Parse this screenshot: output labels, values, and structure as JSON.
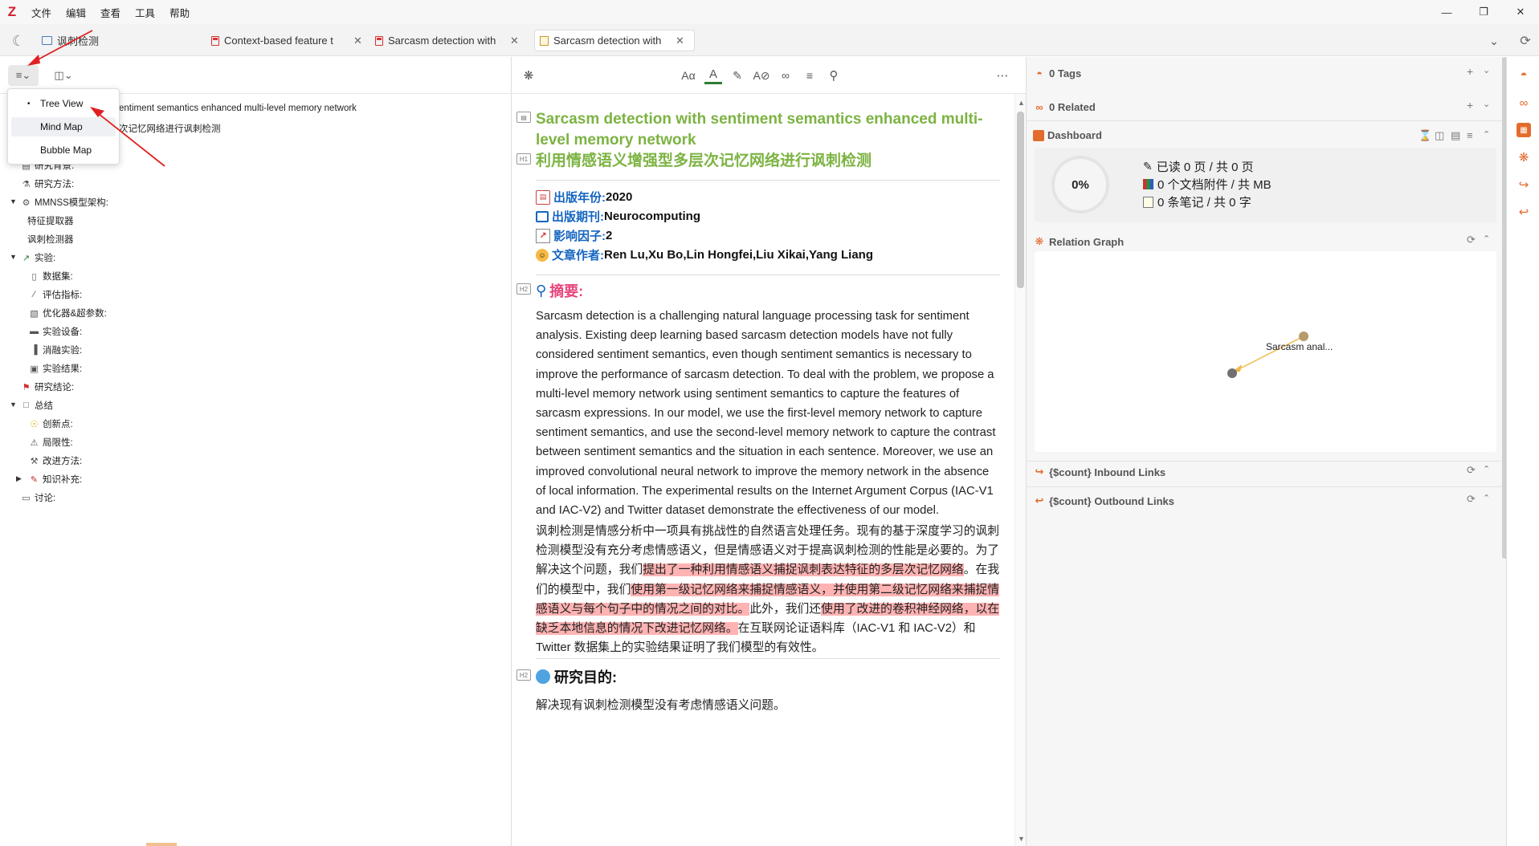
{
  "app": {
    "logo": "Z"
  },
  "menu": [
    "文件",
    "编辑",
    "查看",
    "工具",
    "帮助"
  ],
  "tabs": [
    {
      "label": "讽刺检测",
      "kind": "library"
    },
    {
      "label": "Context-based feature t",
      "kind": "pdf"
    },
    {
      "label": "Sarcasm detection with",
      "kind": "pdf"
    },
    {
      "label": "Sarcasm detection with",
      "kind": "note",
      "active": true
    }
  ],
  "dropdown": {
    "items": [
      "Tree View",
      "Mind Map",
      "Bubble Map"
    ],
    "selected": "Tree View",
    "highlighted": "Mind Map"
  },
  "outline": {
    "root_line1": "entiment semantics enhanced multi-level memory network",
    "root_line2": "次记忆网络进行讽刺检测",
    "items": [
      {
        "label": "研究目的:",
        "icon": "globe-icon",
        "level": 1
      },
      {
        "label": "研究背景:",
        "icon": "calendar-icon",
        "level": 1
      },
      {
        "label": "研究方法:",
        "icon": "flask-icon",
        "level": 1
      },
      {
        "label": "MMNSS模型架构:",
        "icon": "gear-icon",
        "level": 1,
        "expanded": true
      },
      {
        "label": "特征提取器",
        "icon": "",
        "level": 2
      },
      {
        "label": "讽刺检测器",
        "icon": "",
        "level": 2
      },
      {
        "label": "实验:",
        "icon": "test-tube-icon",
        "level": 1,
        "expanded": true
      },
      {
        "label": "数据集:",
        "icon": "database-icon",
        "level": 2
      },
      {
        "label": "评估指标:",
        "icon": "ruler-icon",
        "level": 2
      },
      {
        "label": "优化器&超参数:",
        "icon": "chart-icon",
        "level": 2
      },
      {
        "label": "实验设备:",
        "icon": "laptop-icon",
        "level": 2
      },
      {
        "label": "消融实验:",
        "icon": "bar-chart-icon",
        "level": 2
      },
      {
        "label": "实验结果:",
        "icon": "clipboard-icon",
        "level": 2
      },
      {
        "label": "研究结论:",
        "icon": "flag-icon",
        "level": 1
      },
      {
        "label": "总结",
        "icon": "memo-icon",
        "level": 1,
        "expanded": true
      },
      {
        "label": "创新点:",
        "icon": "lightbulb-icon",
        "level": 2
      },
      {
        "label": "局限性:",
        "icon": "warning-icon",
        "level": 2
      },
      {
        "label": "改进方法:",
        "icon": "wrench-icon",
        "level": 2
      },
      {
        "label": "知识补充:",
        "icon": "pencil-icon",
        "level": 2,
        "collapsed": true
      },
      {
        "label": "讨论:",
        "icon": "speech-icon",
        "level": 1
      }
    ]
  },
  "doc": {
    "title_en": "Sarcasm detection with sentiment semantics enhanced multi-level memory network",
    "title_zh": "利用情感语义增强型多层次记忆网络进行讽刺检测",
    "h1_tag": "H1",
    "h2_tag": "H2",
    "meta": [
      {
        "key": "出版年份:",
        "value": "2020",
        "icon": "calendar-icon"
      },
      {
        "key": "出版期刊:",
        "value": "Neurocomputing",
        "icon": "book-icon"
      },
      {
        "key": "影响因子:",
        "value": "2",
        "icon": "chart-up-icon"
      },
      {
        "key": "文章作者:",
        "value": "Ren Lu,Xu Bo,Lin Hongfei,Liu Xikai,Yang Liang",
        "icon": "person-icon"
      }
    ],
    "abstract_heading": "摘要:",
    "abstract_en": "Sarcasm detection is a challenging natural language processing task for sentiment analysis. Existing deep learning based sarcasm detection models have not fully considered sentiment semantics, even though sentiment semantics is necessary to improve the performance of sarcasm detection. To deal with the problem, we propose a multi-level memory network using sentiment semantics to capture the features of sarcasm expressions. In our model, we use the first-level memory network to capture sentiment semantics, and use the second-level memory network to capture the contrast between sentiment semantics and the situation in each sentence. Moreover, we use an improved convolutional neural network to improve the memory network in the absence of local information. The experimental results on the Internet Argument Corpus (IAC-V1 and IAC-V2) and Twitter dataset demonstrate the effectiveness of our model.",
    "abstract_zh": [
      {
        "t": "讽刺检测是情感分析中一项具有挑战性的自然语言处理任务。现有的基于深度学习的讽刺检测模型没有充分考虑情感语义，但是情感语义对于提高讽刺检测的性能是必要的。为了解决这个问题，我们",
        "hl": false
      },
      {
        "t": "提出了一种利用情感语义捕捉讽刺表达特征的多层次记忆网络",
        "hl": true
      },
      {
        "t": "。在我们的模型中，我们",
        "hl": false
      },
      {
        "t": "使用第一级记忆网络来捕捉情感语义，并使用第二级记忆网络来捕捉情感语义与每个句子中的情况之间的对比。",
        "hl": true
      },
      {
        "t": "此外，我们还",
        "hl": false
      },
      {
        "t": "使用了改进的卷积神经网络，以在缺乏本地信息的情况下改进记忆网络。",
        "hl": true
      },
      {
        "t": "在互联网论证语料库（IAC-V1 和 IAC-V2）和 Twitter 数据集上的实验结果证明了我们模型的有效性。",
        "hl": false
      }
    ],
    "goal_heading": "研究目的:",
    "goal_text": "解决现有讽刺检测模型没有考虑情感语义问题。"
  },
  "right": {
    "tags": "0 Tags",
    "related": "0 Related",
    "dashboard": "Dashboard",
    "progress": "0%",
    "progress_value": 0,
    "read": "已读 0 页 / 共 0 页",
    "attachments": "0 个文档附件 / 共  MB",
    "notes": "0 条笔记 / 共 0 字",
    "relation_graph": "Relation Graph",
    "graph_node": "Sarcasm anal...",
    "inbound": "{$count} Inbound Links",
    "outbound": "{$count} Outbound Links"
  },
  "colors": {
    "accent": "#e36c2c",
    "title_green": "#7cb342",
    "meta_blue": "#1565c0",
    "highlight": "#ffb3b3",
    "abstract_pink": "#e8457a",
    "arrow_red": "#e02020"
  }
}
